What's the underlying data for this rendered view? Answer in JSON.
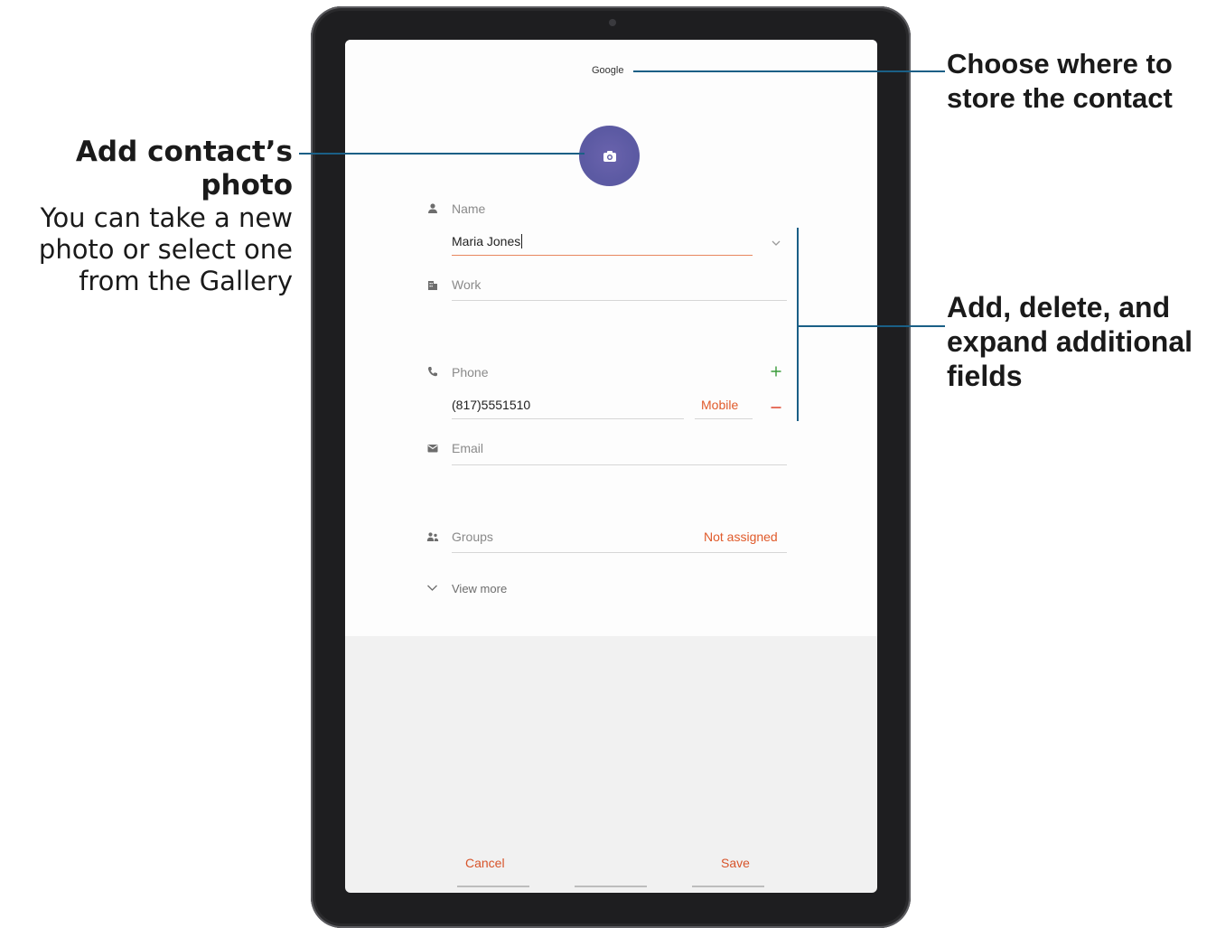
{
  "annotations": {
    "photo": {
      "title": "Add contact’s photo",
      "desc_lines": [
        "You can take a new",
        "photo or select one",
        "from the Gallery"
      ]
    },
    "store": {
      "lines": [
        "Choose where to",
        "store the contact"
      ]
    },
    "fields": {
      "lines": [
        "Add, delete, and",
        "expand additional",
        "fields"
      ]
    }
  },
  "contact_form": {
    "account": "Google",
    "name": {
      "label": "Name",
      "value": "Maria Jones"
    },
    "work": {
      "label": "Work"
    },
    "phone": {
      "label": "Phone",
      "value": "(817)5551510",
      "type": "Mobile"
    },
    "email": {
      "label": "Email"
    },
    "groups": {
      "label": "Groups",
      "value": "Not assigned"
    },
    "view_more": "View more"
  },
  "actions": {
    "cancel": "Cancel",
    "save": "Save"
  },
  "colors": {
    "accent": "#e05a2a",
    "photo_button": "#5c5aa3",
    "add_green": "#3a9b3a",
    "callout_line": "#1a5f86"
  },
  "icons": [
    "camera-icon",
    "person-icon",
    "building-icon",
    "phone-icon",
    "plus-icon",
    "minus-icon",
    "email-icon",
    "group-icon",
    "chevron-down-icon"
  ]
}
